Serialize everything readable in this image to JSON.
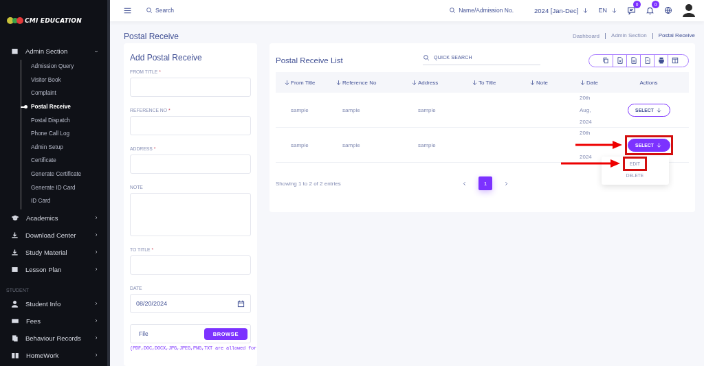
{
  "sidebar": {
    "logo": "CMI EDUCATION",
    "sections": [
      {
        "items": [
          {
            "label": "Admin Section",
            "expanded": true,
            "children": [
              {
                "label": "Admission Query",
                "selected": false
              },
              {
                "label": "Visitor Book",
                "selected": false
              },
              {
                "label": "Complaint",
                "selected": false
              },
              {
                "label": "Postal Receive",
                "selected": true
              },
              {
                "label": "Postal Dispatch",
                "selected": false
              },
              {
                "label": "Phone Call Log",
                "selected": false
              },
              {
                "label": "Admin Setup",
                "selected": false
              },
              {
                "label": "Certificate",
                "selected": false
              },
              {
                "label": "Generate Certificate",
                "selected": false
              },
              {
                "label": "Generate ID Card",
                "selected": false
              },
              {
                "label": "ID Card",
                "selected": false
              }
            ]
          },
          {
            "label": "Academics",
            "expanded": false
          },
          {
            "label": "Download Center",
            "expanded": false
          },
          {
            "label": "Study Material",
            "expanded": false
          },
          {
            "label": "Lesson Plan",
            "expanded": false
          }
        ]
      },
      {
        "heading": "STUDENT",
        "items": [
          {
            "label": "Student Info",
            "expanded": false
          },
          {
            "label": "Fees",
            "expanded": false
          },
          {
            "label": "Behaviour Records",
            "expanded": false
          },
          {
            "label": "HomeWork",
            "expanded": false
          }
        ]
      }
    ]
  },
  "header": {
    "search_placeholder": "Search",
    "student_search_placeholder": "Name/Admission No.",
    "session": "2024 [Jan-Dec]",
    "language": "EN",
    "message_count": "0",
    "notification_count": "0"
  },
  "page": {
    "title": "Postal Receive",
    "breadcrumb": [
      "Dashboard",
      "Admin Section",
      "Postal Receive"
    ]
  },
  "form": {
    "title": "Add Postal Receive",
    "fields": [
      {
        "label": "FROM TITLE",
        "required_mark": "*",
        "kind": "text"
      },
      {
        "label": "REFERENCE NO",
        "required_mark": "*",
        "kind": "text"
      },
      {
        "label": "ADDRESS",
        "required_mark": "*",
        "kind": "text"
      },
      {
        "label": "NOTE",
        "kind": "textarea"
      },
      {
        "label": "TO TITLE",
        "required_mark": "*",
        "kind": "text"
      },
      {
        "label": "DATE",
        "kind": "date",
        "value": "08/20/2024"
      }
    ],
    "file": {
      "placeholder": "File",
      "button": "BROWSE",
      "hint": "(PDF,DOC,DOCX,JPG,JPEG,PNG,TXT are allowed for"
    }
  },
  "list": {
    "title": "Postal Receive List",
    "search_placeholder": "QUICK SEARCH",
    "columns": [
      {
        "label": "From Title",
        "sortable": true
      },
      {
        "label": "Reference No",
        "sortable": true
      },
      {
        "label": "Address",
        "sortable": true
      },
      {
        "label": "To Title",
        "sortable": true
      },
      {
        "label": "Note",
        "sortable": true
      },
      {
        "label": "Date",
        "sortable": true
      },
      {
        "label": "Actions",
        "sortable": false
      }
    ],
    "rows": [
      {
        "from_title": "sample",
        "reference_no": "sample",
        "address": "sample",
        "date_lines": [
          "20th",
          "Aug,",
          "2024"
        ],
        "action": {
          "label": "SELECT",
          "selected": false,
          "highlighted": false
        }
      },
      {
        "from_title": "sample",
        "reference_no": "sample",
        "address": "sample",
        "date_lines": [
          "20th",
          "2024"
        ],
        "action": {
          "label": "SELECT",
          "selected": true,
          "highlighted": true,
          "menu": [
            {
              "label": "EDIT",
              "highlighted": true
            },
            {
              "label": "DELETE",
              "highlighted": false
            }
          ]
        }
      }
    ],
    "summary": "Showing 1 to 2 of 2 entries",
    "pages": [
      {
        "label": "1",
        "selected": true
      }
    ]
  }
}
